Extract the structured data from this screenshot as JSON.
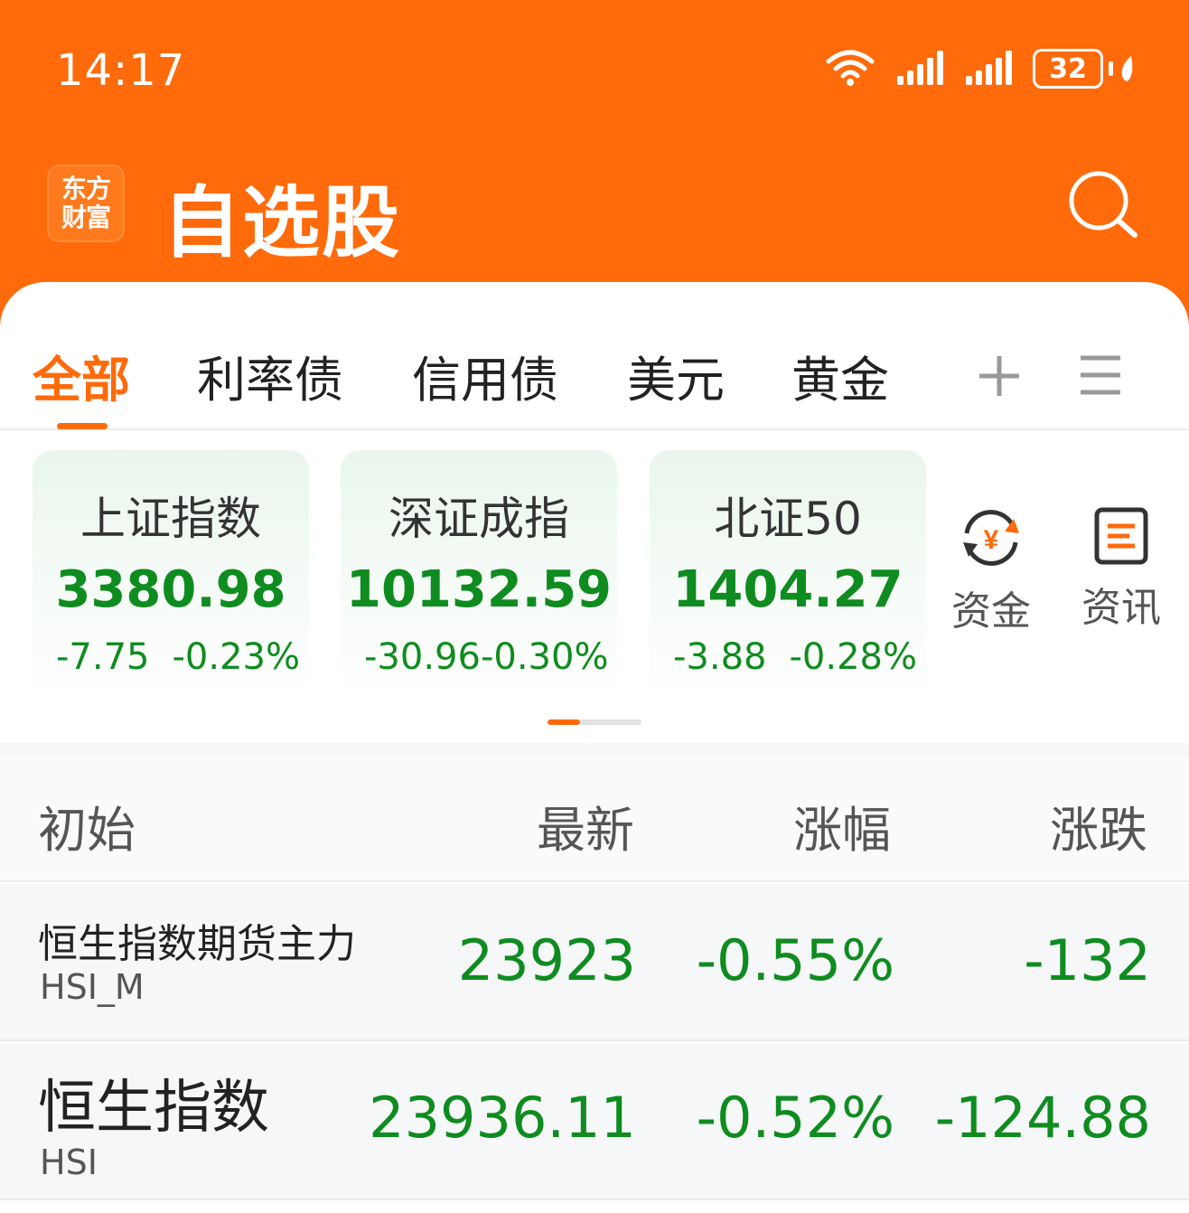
{
  "status_bar": {
    "time": "14:17",
    "battery": "32",
    "icons": [
      "wifi-icon",
      "signal-icon",
      "signal-icon",
      "battery-icon",
      "charging-leaf-icon"
    ]
  },
  "header": {
    "logo_line1": "东方",
    "logo_line2": "财富",
    "title": "自选股",
    "search_icon": "search-icon"
  },
  "tabs": [
    {
      "label": "全部",
      "active": true
    },
    {
      "label": "利率债",
      "active": false
    },
    {
      "label": "信用债",
      "active": false
    },
    {
      "label": "美元",
      "active": false
    },
    {
      "label": "黄金",
      "active": false
    }
  ],
  "tab_actions": [
    "add-icon",
    "menu-icon"
  ],
  "indices": [
    {
      "name": "上证指数",
      "value": "3380.98",
      "change": "-7.75",
      "change_pct": "-0.23%"
    },
    {
      "name": "深证成指",
      "value": "10132.59",
      "change": "-30.96",
      "change_pct": "-0.30%"
    },
    {
      "name": "北证50",
      "value": "1404.27",
      "change": "-3.88",
      "change_pct": "-0.28%"
    }
  ],
  "quick_links": [
    {
      "label": "资金",
      "icon": "fund-flow-icon"
    },
    {
      "label": "资讯",
      "icon": "news-icon"
    }
  ],
  "list": {
    "columns": {
      "name": "初始",
      "latest": "最新",
      "change_pct": "涨幅",
      "change": "涨跌"
    },
    "rows": [
      {
        "name": "恒生指数期货主力",
        "code": "HSI_M",
        "latest": "23923",
        "change_pct": "-0.55%",
        "change": "-132"
      },
      {
        "name": "恒生指数",
        "code": "HSI",
        "latest": "23936.11",
        "change_pct": "-0.52%",
        "change": "-124.88"
      }
    ]
  },
  "colors": {
    "brand": "#ff6a0a",
    "down_green": "#0f8c1f"
  }
}
